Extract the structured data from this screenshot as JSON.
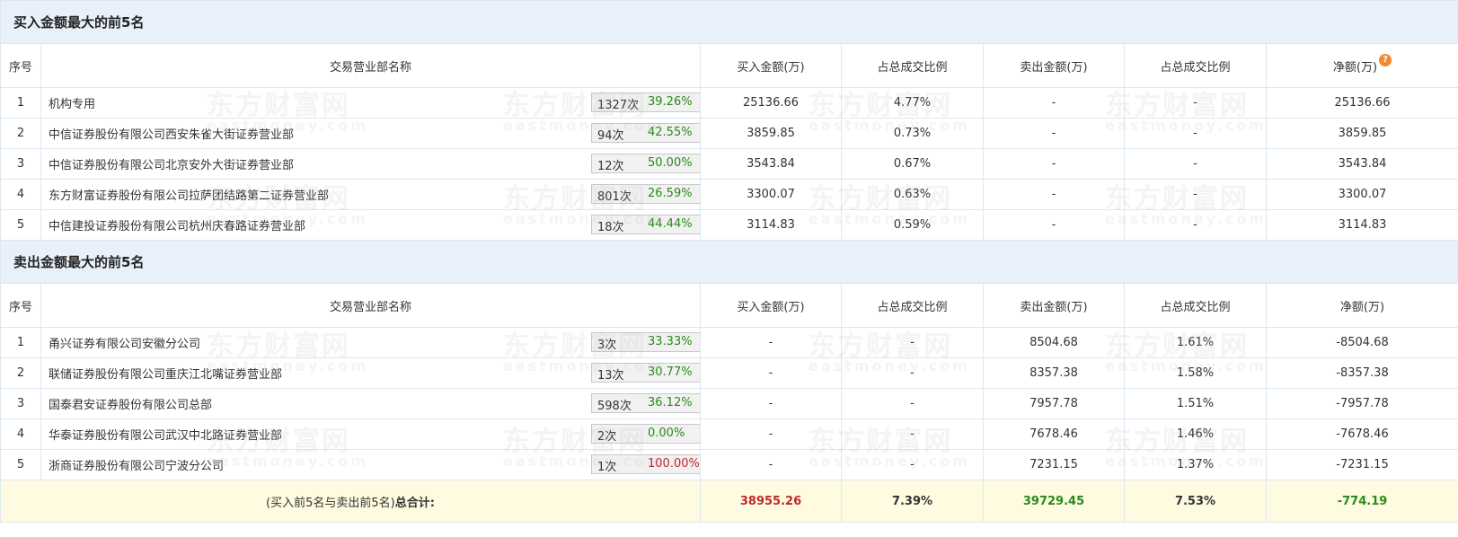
{
  "watermark": {
    "cn": "东方财富网",
    "en": "eastmoney.com"
  },
  "columns": {
    "seq": "序号",
    "name": "交易营业部名称",
    "buy": "买入金额(万)",
    "buy_ratio": "占总成交比例",
    "sell": "卖出金额(万)",
    "sell_ratio": "占总成交比例",
    "net": "净额(万)"
  },
  "icons": {
    "help": "?"
  },
  "colors": {
    "red": "#c0282d",
    "green": "#2a8a1a",
    "header_bg": "#e8f1fa",
    "total_bg": "#fefbe0"
  },
  "buy_section": {
    "title": "买入金额最大的前5名",
    "rows": [
      {
        "seq": "1",
        "name": "机构专用",
        "count": "1327次",
        "pct": "39.26%",
        "pct_color": "green",
        "btn": "help",
        "buy": "25136.66",
        "buy_ratio": "4.77%",
        "sell": "-",
        "sell_ratio": "-",
        "net": "25136.66"
      },
      {
        "seq": "2",
        "name": "中信证券股份有限公司西安朱雀大街证券营业部",
        "count": "94次",
        "pct": "42.55%",
        "pct_color": "green",
        "btn": "arrow",
        "buy": "3859.85",
        "buy_ratio": "0.73%",
        "sell": "-",
        "sell_ratio": "-",
        "net": "3859.85"
      },
      {
        "seq": "3",
        "name": "中信证券股份有限公司北京安外大街证券营业部",
        "count": "12次",
        "pct": "50.00%",
        "pct_color": "green",
        "btn": "arrow",
        "buy": "3543.84",
        "buy_ratio": "0.67%",
        "sell": "-",
        "sell_ratio": "-",
        "net": "3543.84"
      },
      {
        "seq": "4",
        "name": "东方财富证券股份有限公司拉萨团结路第二证券营业部",
        "count": "801次",
        "pct": "26.59%",
        "pct_color": "green",
        "btn": "arrow",
        "buy": "3300.07",
        "buy_ratio": "0.63%",
        "sell": "-",
        "sell_ratio": "-",
        "net": "3300.07"
      },
      {
        "seq": "5",
        "name": "中信建投证券股份有限公司杭州庆春路证券营业部",
        "count": "18次",
        "pct": "44.44%",
        "pct_color": "green",
        "btn": "arrow",
        "buy": "3114.83",
        "buy_ratio": "0.59%",
        "sell": "-",
        "sell_ratio": "-",
        "net": "3114.83"
      }
    ]
  },
  "sell_section": {
    "title": "卖出金额最大的前5名",
    "rows": [
      {
        "seq": "1",
        "name": "甬兴证券有限公司安徽分公司",
        "count": "3次",
        "pct": "33.33%",
        "pct_color": "green",
        "btn": "help",
        "buy": "-",
        "buy_ratio": "-",
        "sell": "8504.68",
        "sell_ratio": "1.61%",
        "net": "-8504.68"
      },
      {
        "seq": "2",
        "name": "联储证券股份有限公司重庆江北嘴证券营业部",
        "count": "13次",
        "pct": "30.77%",
        "pct_color": "green",
        "btn": "arrow",
        "buy": "-",
        "buy_ratio": "-",
        "sell": "8357.38",
        "sell_ratio": "1.58%",
        "net": "-8357.38"
      },
      {
        "seq": "3",
        "name": "国泰君安证券股份有限公司总部",
        "count": "598次",
        "pct": "36.12%",
        "pct_color": "green",
        "btn": "arrow",
        "buy": "-",
        "buy_ratio": "-",
        "sell": "7957.78",
        "sell_ratio": "1.51%",
        "net": "-7957.78"
      },
      {
        "seq": "4",
        "name": "华泰证券股份有限公司武汉中北路证券营业部",
        "count": "2次",
        "pct": "0.00%",
        "pct_color": "green",
        "btn": "arrow",
        "buy": "-",
        "buy_ratio": "-",
        "sell": "7678.46",
        "sell_ratio": "1.46%",
        "net": "-7678.46"
      },
      {
        "seq": "5",
        "name": "浙商证券股份有限公司宁波分公司",
        "count": "1次",
        "pct": "100.00%",
        "pct_color": "red",
        "btn": "arrow",
        "buy": "-",
        "buy_ratio": "-",
        "sell": "7231.15",
        "sell_ratio": "1.37%",
        "net": "-7231.15"
      }
    ]
  },
  "total": {
    "label_prefix": "(买入前5名与卖出前5名)",
    "label_bold": "总合计:",
    "buy": "38955.26",
    "buy_ratio": "7.39%",
    "sell": "39729.45",
    "sell_ratio": "7.53%",
    "net": "-774.19"
  }
}
